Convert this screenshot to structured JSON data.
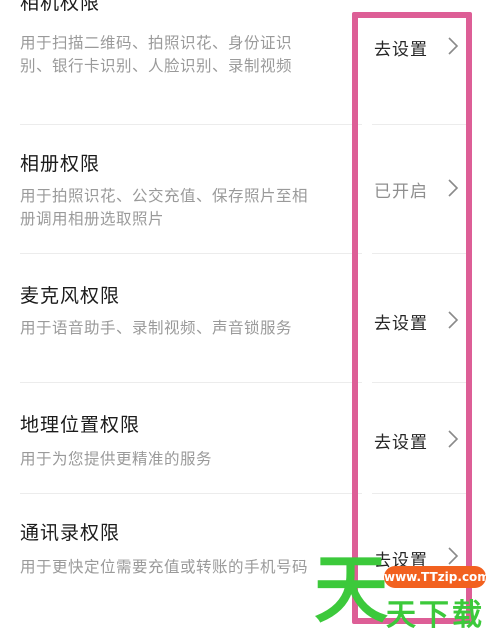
{
  "permissions": [
    {
      "title": "相机权限",
      "description": "用于扫描二维码、拍照识花、身份证识别、银行卡识别、人脸识别、录制视频",
      "status": "去设置"
    },
    {
      "title": "相册权限",
      "description": "用于拍照识花、公交充值、保存照片至相册调用相册选取照片",
      "status": "已开启"
    },
    {
      "title": "麦克风权限",
      "description": "用于语音助手、录制视频、声音锁服务",
      "status": "去设置"
    },
    {
      "title": "地理位置权限",
      "description": "用于为您提供更精准的服务",
      "status": "去设置"
    },
    {
      "title": "通讯录权限",
      "description": "用于更快定位需要充值或转账的手机号码",
      "status": "去设置"
    }
  ],
  "watermark": {
    "glyph": "天",
    "site": "www.TTzip.com",
    "name": "天下载"
  },
  "colors": {
    "highlight_border": "#dd5e96",
    "watermark_green": "#3cc93b",
    "watermark_orange": "#f2611f"
  }
}
